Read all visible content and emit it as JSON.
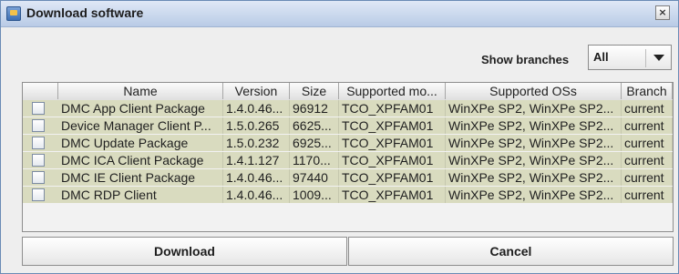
{
  "window": {
    "title": "Download software",
    "close_glyph": "×"
  },
  "filter": {
    "label": "Show branches",
    "selected": "All"
  },
  "table": {
    "columns": [
      "",
      "Name",
      "Version",
      "Size",
      "Supported mo...",
      "Supported OSs",
      "Branch"
    ],
    "rows": [
      {
        "name": "DMC App Client Package",
        "version": "1.4.0.46...",
        "size": "96912",
        "model": "TCO_XPFAM01",
        "os": "WinXPe SP2, WinXPe SP2...",
        "branch": "current"
      },
      {
        "name": "Device Manager Client P...",
        "version": "1.5.0.265",
        "size": "6625...",
        "model": "TCO_XPFAM01",
        "os": "WinXPe SP2, WinXPe SP2...",
        "branch": "current"
      },
      {
        "name": "DMC Update Package",
        "version": "1.5.0.232",
        "size": "6925...",
        "model": "TCO_XPFAM01",
        "os": "WinXPe SP2, WinXPe SP2...",
        "branch": "current"
      },
      {
        "name": "DMC ICA Client Package",
        "version": "1.4.1.127",
        "size": "1170...",
        "model": "TCO_XPFAM01",
        "os": "WinXPe SP2, WinXPe SP2...",
        "branch": "current"
      },
      {
        "name": "DMC IE Client Package",
        "version": "1.4.0.46...",
        "size": "97440",
        "model": "TCO_XPFAM01",
        "os": "WinXPe SP2, WinXPe SP2...",
        "branch": "current"
      },
      {
        "name": "DMC RDP Client",
        "version": "1.4.0.46...",
        "size": "1009...",
        "model": "TCO_XPFAM01",
        "os": "WinXPe SP2, WinXPe SP2...",
        "branch": "current"
      }
    ]
  },
  "buttons": {
    "download": "Download",
    "cancel": "Cancel"
  },
  "icons": {
    "app": "java-app-icon",
    "close": "close-icon",
    "dropdown": "chevron-down-icon",
    "checkbox": "checkbox-icon"
  },
  "colors": {
    "selected_row": "#d9dbbf",
    "window_bg": "#eeeeee",
    "title_bg": "#b9cbe6"
  }
}
